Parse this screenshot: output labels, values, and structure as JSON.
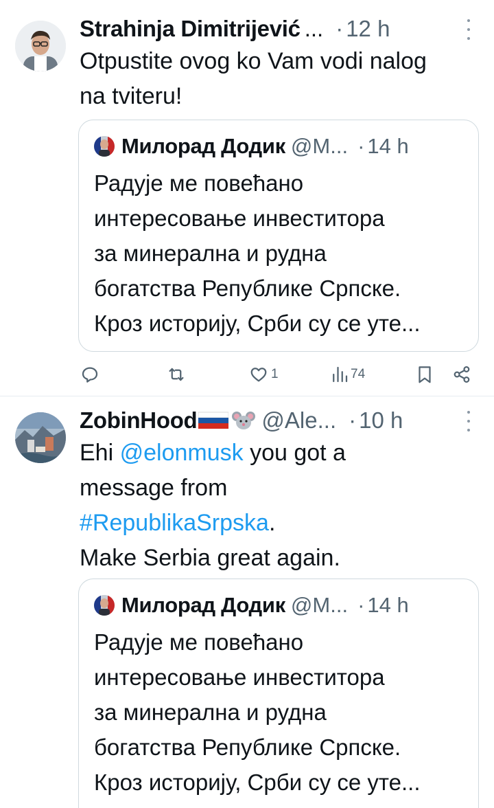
{
  "tweets": [
    {
      "author": "Strahinja Dimitrijević",
      "author_trunc": "...",
      "handle": "",
      "time": "12 h",
      "text_lines": [
        "Otpustite ovog ko Vam vodi nalog",
        "na tviteru!"
      ],
      "quote": {
        "author": "Милорад Додик",
        "handle": "@M...",
        "time": "14 h",
        "text_lines": [
          "Радује ме повећано",
          "интересовање инвеститора",
          "за минерална и рудна",
          "богатства Републике Српске.",
          "Кроз историју, Срби су се уте..."
        ]
      },
      "actions": {
        "reply_icon": "reply-icon",
        "retweet_icon": "retweet-icon",
        "like_icon": "heart-icon",
        "like_count": "1",
        "views_icon": "views-icon",
        "views_count": "74",
        "bookmark_icon": "bookmark-icon",
        "share_icon": "share-icon"
      }
    },
    {
      "author": "ZobinHood",
      "emoji": "🇷🇺🐭",
      "handle": "@Ale...",
      "time": "10 h",
      "text": {
        "line1_prefix": "Ehi ",
        "mention": "@elonmusk",
        "line1_suffix": " you got a",
        "line2": "message from",
        "hashtag": "#RepublikaSrpska",
        "hashtag_suffix": ".",
        "line4": "Make Serbia great again."
      },
      "quote": {
        "author": "Милорад Додик",
        "handle": "@M...",
        "time": "14 h",
        "text_lines": [
          "Радује ме повећано",
          "интересовање инвеститора",
          "за минерална и рудна",
          "богатства Републике Српске.",
          "Кроз историју, Срби су се уте..."
        ]
      }
    }
  ],
  "colors": {
    "text": "#0f1419",
    "secondary": "#536471",
    "link": "#1d9bf0",
    "border": "#cfd9de"
  }
}
